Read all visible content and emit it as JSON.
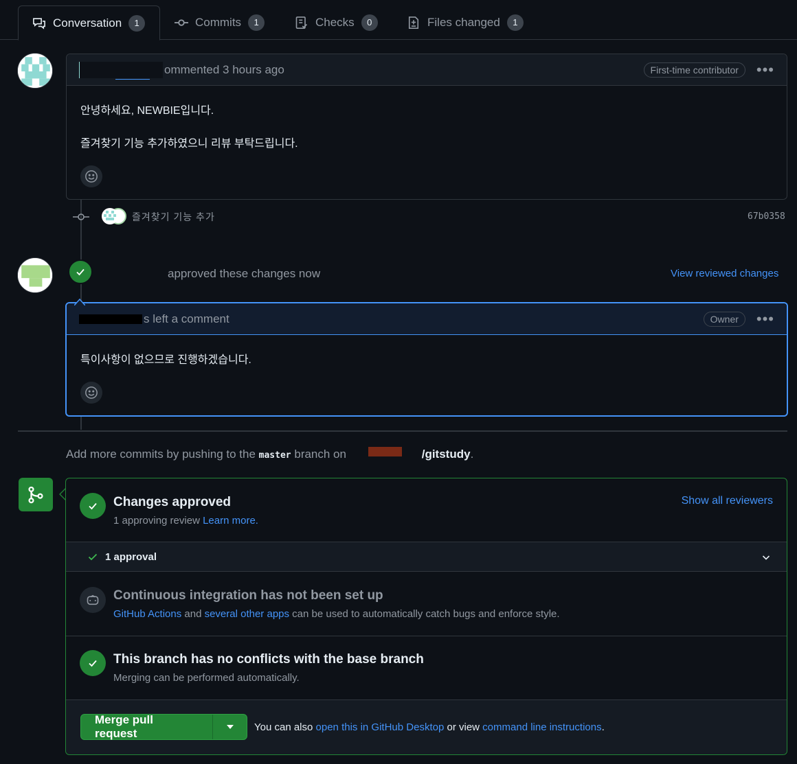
{
  "tabs": [
    {
      "label": "Conversation",
      "count": "1"
    },
    {
      "label": "Commits",
      "count": "1"
    },
    {
      "label": "Checks",
      "count": "0"
    },
    {
      "label": "Files changed",
      "count": "1"
    }
  ],
  "first_comment": {
    "header_text": "ommented 3 hours ago",
    "role": "First-time contributor",
    "body_line1": "안녕하세요, NEWBIE입니다.",
    "body_line2": "즐겨찾기 기능 추가하였으니 리뷰 부탁드립니다."
  },
  "commit": {
    "message": "즐겨찾기 기능 추가",
    "sha": "67b0358"
  },
  "review": {
    "action_text": "approved these changes now",
    "view_link": "View reviewed changes"
  },
  "owner_comment": {
    "header_text": "s left a comment",
    "role": "Owner",
    "body": "특이사항이 없으므로 진행하겠습니다."
  },
  "push_hint": {
    "prefix": "Add more commits by pushing to the",
    "branch": "master",
    "middle": "branch on",
    "repo": "/gitstudy",
    "suffix": "."
  },
  "merge": {
    "approved_title": "Changes approved",
    "approved_sub": "1 approving review",
    "learn_more": "Learn more.",
    "show_reviewers": "Show all reviewers",
    "approval_count": "1 approval",
    "ci_title": "Continuous integration has not been set up",
    "ci_link1": "GitHub Actions",
    "ci_and": "and",
    "ci_link2": "several other apps",
    "ci_rest": "can be used to automatically catch bugs and enforce style.",
    "conflict_title": "This branch has no conflicts with the base branch",
    "conflict_sub": "Merging can be performed automatically.",
    "merge_button": "Merge pull request",
    "also_prefix": "You can also",
    "desktop_link": "open this in GitHub Desktop",
    "or_view": "or view",
    "cli_link": "command line instructions",
    "period": "."
  },
  "colors": {
    "background": "#0d1117",
    "green": "#238636",
    "link": "#4493f8",
    "border": "#30363d",
    "owner_border": "#4493f8"
  }
}
